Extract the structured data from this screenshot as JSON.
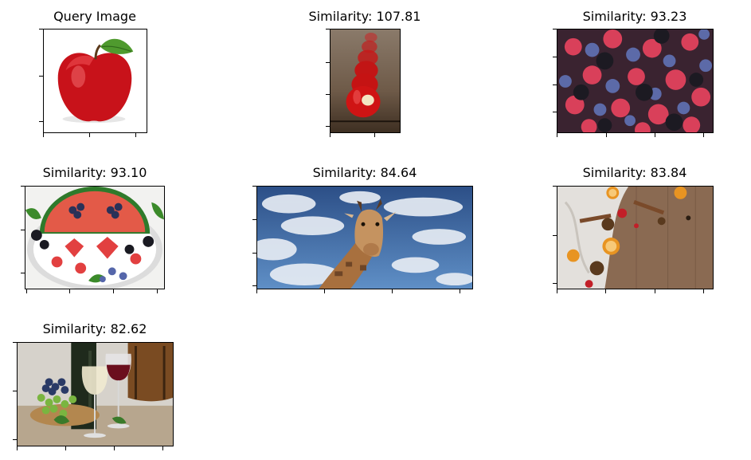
{
  "figure": {
    "panels": [
      {
        "title": "Query Image",
        "image": "red-apple"
      },
      {
        "title": "Similarity: 107.81",
        "image": "apples-in-row"
      },
      {
        "title": "Similarity: 93.23",
        "image": "mixed-berries"
      },
      {
        "title": "Similarity: 93.10",
        "image": "watermelon-berry-plate"
      },
      {
        "title": "Similarity: 84.64",
        "image": "giraffe-sky"
      },
      {
        "title": "Similarity: 83.84",
        "image": "spices-on-wood"
      },
      {
        "title": "Similarity: 82.62",
        "image": "wine-grapes-barrel"
      }
    ]
  }
}
